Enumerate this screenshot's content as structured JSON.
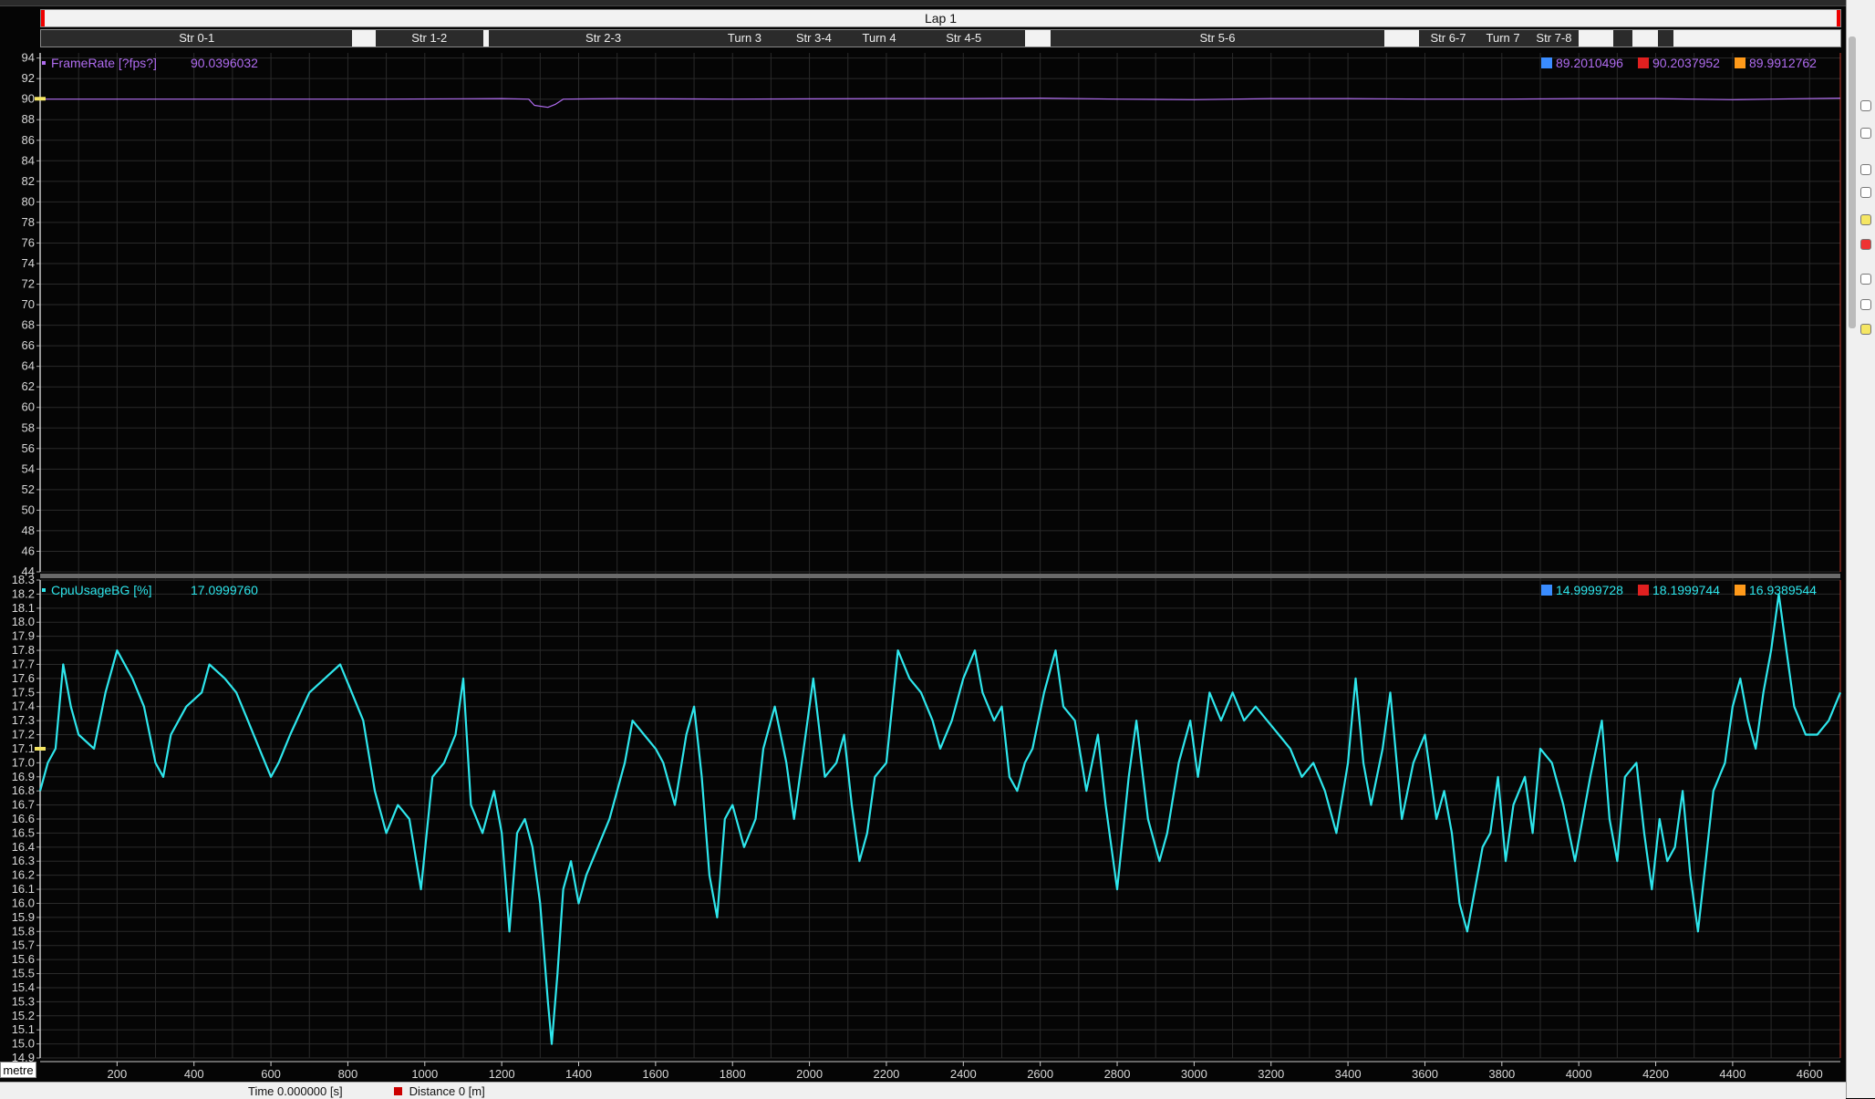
{
  "lap_label": "Lap 1",
  "segments": [
    {
      "label": "Str 0-1",
      "x0": 0,
      "x1": 810
    },
    {
      "label": "",
      "x0": 810,
      "x1": 870
    },
    {
      "label": "Str 1-2",
      "x0": 870,
      "x1": 1150
    },
    {
      "label": "",
      "x0": 1150,
      "x1": 1165
    },
    {
      "label": "Str 2-3",
      "x0": 1165,
      "x1": 1760
    },
    {
      "label": "Turn 3",
      "x0": 1760,
      "x1": 1900
    },
    {
      "label": "Str 3-4",
      "x0": 1900,
      "x1": 2120
    },
    {
      "label": "Turn 4",
      "x0": 2120,
      "x1": 2240
    },
    {
      "label": "Str 4-5",
      "x0": 2240,
      "x1": 2560
    },
    {
      "label": "",
      "x0": 2560,
      "x1": 2625
    },
    {
      "label": "Str 5-6",
      "x0": 2625,
      "x1": 3495
    },
    {
      "label": "",
      "x0": 3495,
      "x1": 3585
    },
    {
      "label": "Str 6-7",
      "x0": 3585,
      "x1": 3735
    },
    {
      "label": "Turn 7",
      "x0": 3735,
      "x1": 3870
    },
    {
      "label": "Str 7-8",
      "x0": 3870,
      "x1": 4000
    },
    {
      "label": "",
      "x0": 4000,
      "x1": 4090
    },
    {
      "label": "",
      "x0": 4090,
      "x1": 4140
    },
    {
      "label": "",
      "x0": 4140,
      "x1": 4205
    },
    {
      "label": "",
      "x0": 4205,
      "x1": 4245
    },
    {
      "label": "",
      "x0": 4245,
      "x1": 4680
    }
  ],
  "status": {
    "unit": "metre",
    "time_label": "Time",
    "time_value": "0.000000 [s]",
    "distance_label": "Distance",
    "distance_value": "0 [m]"
  },
  "colors": {
    "background": "#050505",
    "grid": "#2a2a2a",
    "axis_text": "#d8d8d8",
    "framerate": "#b06cf0",
    "cpu": "#2ee6ec"
  },
  "chart_data": [
    {
      "type": "line",
      "channel": "FrameRate [?fps?]",
      "current": "90.0396032",
      "min": "89.2010496",
      "max": "90.2037952",
      "avg": "89.9912762",
      "xlabel": "metre",
      "xlim": [
        0,
        4680
      ],
      "ylim": [
        44,
        94.5
      ],
      "yticks": [
        44,
        46,
        48,
        50,
        52,
        54,
        56,
        58,
        60,
        62,
        64,
        66,
        68,
        70,
        72,
        74,
        76,
        78,
        80,
        82,
        84,
        86,
        88,
        90,
        92,
        94
      ],
      "grid": true,
      "points": [
        [
          0,
          90.0
        ],
        [
          300,
          90.0
        ],
        [
          600,
          90.0
        ],
        [
          900,
          90.0
        ],
        [
          1200,
          90.05
        ],
        [
          1270,
          90.0
        ],
        [
          1285,
          89.4
        ],
        [
          1320,
          89.2
        ],
        [
          1340,
          89.5
        ],
        [
          1360,
          90.0
        ],
        [
          1500,
          90.05
        ],
        [
          1800,
          90.0
        ],
        [
          2200,
          90.05
        ],
        [
          2400,
          90.05
        ],
        [
          2600,
          90.1
        ],
        [
          2800,
          90.0
        ],
        [
          3000,
          89.95
        ],
        [
          3200,
          90.05
        ],
        [
          3400,
          90.05
        ],
        [
          3600,
          90.0
        ],
        [
          3800,
          90.0
        ],
        [
          4000,
          90.05
        ],
        [
          4200,
          90.05
        ],
        [
          4400,
          89.95
        ],
        [
          4500,
          90.0
        ],
        [
          4680,
          90.1
        ]
      ]
    },
    {
      "type": "line",
      "channel": "CpuUsageBG [%]",
      "current": "17.0999760",
      "min": "14.9999728",
      "max": "18.1999744",
      "avg": "16.9389544",
      "xlabel": "metre",
      "xlim": [
        0,
        4680
      ],
      "ylim": [
        14.9,
        18.3
      ],
      "yticks": [
        14.9,
        15.0,
        15.1,
        15.2,
        15.3,
        15.4,
        15.5,
        15.6,
        15.7,
        15.8,
        15.9,
        16.0,
        16.1,
        16.2,
        16.3,
        16.4,
        16.5,
        16.6,
        16.7,
        16.8,
        16.9,
        17.0,
        17.1,
        17.2,
        17.3,
        17.4,
        17.5,
        17.6,
        17.7,
        17.8,
        17.9,
        18.0,
        18.1,
        18.2,
        18.3
      ],
      "grid": true,
      "points": [
        [
          0,
          16.8
        ],
        [
          20,
          17.0
        ],
        [
          40,
          17.1
        ],
        [
          60,
          17.7
        ],
        [
          80,
          17.4
        ],
        [
          100,
          17.2
        ],
        [
          140,
          17.1
        ],
        [
          170,
          17.5
        ],
        [
          200,
          17.8
        ],
        [
          240,
          17.6
        ],
        [
          270,
          17.4
        ],
        [
          300,
          17.0
        ],
        [
          320,
          16.9
        ],
        [
          340,
          17.2
        ],
        [
          380,
          17.4
        ],
        [
          420,
          17.5
        ],
        [
          440,
          17.7
        ],
        [
          480,
          17.6
        ],
        [
          510,
          17.5
        ],
        [
          540,
          17.3
        ],
        [
          570,
          17.1
        ],
        [
          600,
          16.9
        ],
        [
          620,
          17.0
        ],
        [
          650,
          17.2
        ],
        [
          700,
          17.5
        ],
        [
          740,
          17.6
        ],
        [
          780,
          17.7
        ],
        [
          810,
          17.5
        ],
        [
          840,
          17.3
        ],
        [
          870,
          16.8
        ],
        [
          900,
          16.5
        ],
        [
          930,
          16.7
        ],
        [
          960,
          16.6
        ],
        [
          990,
          16.1
        ],
        [
          1020,
          16.9
        ],
        [
          1050,
          17.0
        ],
        [
          1080,
          17.2
        ],
        [
          1100,
          17.6
        ],
        [
          1120,
          16.7
        ],
        [
          1150,
          16.5
        ],
        [
          1180,
          16.8
        ],
        [
          1200,
          16.5
        ],
        [
          1220,
          15.8
        ],
        [
          1240,
          16.5
        ],
        [
          1260,
          16.6
        ],
        [
          1280,
          16.4
        ],
        [
          1300,
          16.0
        ],
        [
          1320,
          15.3
        ],
        [
          1330,
          15.0
        ],
        [
          1345,
          15.5
        ],
        [
          1360,
          16.1
        ],
        [
          1380,
          16.3
        ],
        [
          1400,
          16.0
        ],
        [
          1420,
          16.2
        ],
        [
          1450,
          16.4
        ],
        [
          1480,
          16.6
        ],
        [
          1520,
          17.0
        ],
        [
          1540,
          17.3
        ],
        [
          1570,
          17.2
        ],
        [
          1600,
          17.1
        ],
        [
          1620,
          17.0
        ],
        [
          1650,
          16.7
        ],
        [
          1680,
          17.2
        ],
        [
          1700,
          17.4
        ],
        [
          1720,
          16.9
        ],
        [
          1740,
          16.2
        ],
        [
          1760,
          15.9
        ],
        [
          1780,
          16.6
        ],
        [
          1800,
          16.7
        ],
        [
          1830,
          16.4
        ],
        [
          1860,
          16.6
        ],
        [
          1880,
          17.1
        ],
        [
          1910,
          17.4
        ],
        [
          1940,
          17.0
        ],
        [
          1960,
          16.6
        ],
        [
          1990,
          17.2
        ],
        [
          2010,
          17.6
        ],
        [
          2040,
          16.9
        ],
        [
          2070,
          17.0
        ],
        [
          2090,
          17.2
        ],
        [
          2110,
          16.7
        ],
        [
          2130,
          16.3
        ],
        [
          2150,
          16.5
        ],
        [
          2170,
          16.9
        ],
        [
          2200,
          17.0
        ],
        [
          2230,
          17.8
        ],
        [
          2260,
          17.6
        ],
        [
          2290,
          17.5
        ],
        [
          2320,
          17.3
        ],
        [
          2340,
          17.1
        ],
        [
          2370,
          17.3
        ],
        [
          2400,
          17.6
        ],
        [
          2430,
          17.8
        ],
        [
          2450,
          17.5
        ],
        [
          2480,
          17.3
        ],
        [
          2500,
          17.4
        ],
        [
          2520,
          16.9
        ],
        [
          2540,
          16.8
        ],
        [
          2560,
          17.0
        ],
        [
          2580,
          17.1
        ],
        [
          2610,
          17.5
        ],
        [
          2640,
          17.8
        ],
        [
          2660,
          17.4
        ],
        [
          2690,
          17.3
        ],
        [
          2720,
          16.8
        ],
        [
          2750,
          17.2
        ],
        [
          2770,
          16.7
        ],
        [
          2800,
          16.1
        ],
        [
          2830,
          16.9
        ],
        [
          2850,
          17.3
        ],
        [
          2880,
          16.6
        ],
        [
          2910,
          16.3
        ],
        [
          2930,
          16.5
        ],
        [
          2960,
          17.0
        ],
        [
          2990,
          17.3
        ],
        [
          3010,
          16.9
        ],
        [
          3040,
          17.5
        ],
        [
          3070,
          17.3
        ],
        [
          3100,
          17.5
        ],
        [
          3130,
          17.3
        ],
        [
          3160,
          17.4
        ],
        [
          3190,
          17.3
        ],
        [
          3220,
          17.2
        ],
        [
          3250,
          17.1
        ],
        [
          3280,
          16.9
        ],
        [
          3310,
          17.0
        ],
        [
          3340,
          16.8
        ],
        [
          3370,
          16.5
        ],
        [
          3400,
          17.0
        ],
        [
          3420,
          17.6
        ],
        [
          3440,
          17.0
        ],
        [
          3460,
          16.7
        ],
        [
          3490,
          17.1
        ],
        [
          3510,
          17.5
        ],
        [
          3540,
          16.6
        ],
        [
          3570,
          17.0
        ],
        [
          3600,
          17.2
        ],
        [
          3630,
          16.6
        ],
        [
          3650,
          16.8
        ],
        [
          3670,
          16.5
        ],
        [
          3690,
          16.0
        ],
        [
          3710,
          15.8
        ],
        [
          3730,
          16.1
        ],
        [
          3750,
          16.4
        ],
        [
          3770,
          16.5
        ],
        [
          3790,
          16.9
        ],
        [
          3810,
          16.3
        ],
        [
          3830,
          16.7
        ],
        [
          3860,
          16.9
        ],
        [
          3880,
          16.5
        ],
        [
          3900,
          17.1
        ],
        [
          3930,
          17.0
        ],
        [
          3960,
          16.7
        ],
        [
          3990,
          16.3
        ],
        [
          4010,
          16.6
        ],
        [
          4030,
          16.9
        ],
        [
          4060,
          17.3
        ],
        [
          4080,
          16.6
        ],
        [
          4100,
          16.3
        ],
        [
          4120,
          16.9
        ],
        [
          4150,
          17.0
        ],
        [
          4170,
          16.5
        ],
        [
          4190,
          16.1
        ],
        [
          4210,
          16.6
        ],
        [
          4230,
          16.3
        ],
        [
          4250,
          16.4
        ],
        [
          4270,
          16.8
        ],
        [
          4290,
          16.2
        ],
        [
          4310,
          15.8
        ],
        [
          4330,
          16.3
        ],
        [
          4350,
          16.8
        ],
        [
          4380,
          17.0
        ],
        [
          4400,
          17.4
        ],
        [
          4420,
          17.6
        ],
        [
          4440,
          17.3
        ],
        [
          4460,
          17.1
        ],
        [
          4480,
          17.5
        ],
        [
          4500,
          17.8
        ],
        [
          4520,
          18.2
        ],
        [
          4540,
          17.8
        ],
        [
          4560,
          17.4
        ],
        [
          4590,
          17.2
        ],
        [
          4620,
          17.2
        ],
        [
          4650,
          17.3
        ],
        [
          4680,
          17.5
        ]
      ]
    }
  ]
}
